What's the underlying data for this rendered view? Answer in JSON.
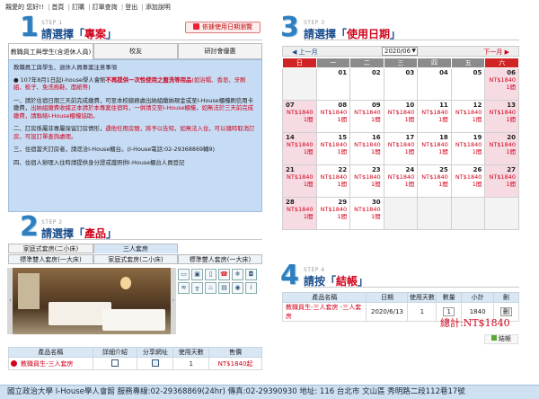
{
  "topnav": {
    "welcome": "親愛的 您好!!",
    "items": [
      "首頁",
      "訂購",
      "訂單查詢",
      "登出",
      "添加說明"
    ]
  },
  "step1": {
    "num": "1",
    "label": "STEP 1",
    "title_pre": "請選擇「",
    "title_key": "專案",
    "title_post": "」",
    "rule_button": "依據使用日期瀏覽",
    "tabs": [
      "教職員工與學生(含退休人員)",
      "校友",
      "研討會優惠"
    ],
    "heading": "教職員工與學生、退休人員專案注意事項",
    "notice_a": "107年8月1日起I-house學人會館",
    "notice_b": "不再提供一次性使用之盥洗等用品",
    "notice_c": "(如浴帽、香皂、牙刷組、梳子、免洗拖鞋、面紙等)",
    "p1": "一、請於住宿日期三天前完成繳費，可至本校總務處出納組繳納現金或至I-House櫃檯刷信用卡繳費，",
    "p1_red": "出納組繳費收據正本請於本專案住宿時，一併請交至I-House櫃檯，如無法於三天前完成繳費，請聯絡I-House櫃檯協助。",
    "p2": "二、訂房係屬非專屬保留訂房情形，",
    "p2_red": "遇他任用房間，將予以告知，如無法入住，可以隨時取消訂房，可設訂單查詢處理。",
    "p3": "三、住宿當天訂房者，請逕洽I-House櫃台。(I-House電話:02-29368869轉9)",
    "p4": "四、住宿人辦理入住時請提供身分證或護照供I-House櫃台人員登記"
  },
  "step2": {
    "num": "2",
    "label": "STEP 2",
    "title_pre": "請選擇「",
    "title_key": "產品",
    "title_post": "」",
    "tabs": [
      "家庭式套房(二小床)",
      "三人套房",
      ""
    ],
    "subtabs": [
      "標準雙人套房(一大床)",
      "家庭式套房(二小床)",
      "標準雙人套房(一大床)"
    ],
    "icons": [
      "bed-icon",
      "tv-icon",
      "fridge-icon",
      "phone-icon",
      "ac-icon",
      "safe-icon",
      "wifi-icon",
      "desk-icon",
      "lamp-icon",
      "towel-icon",
      "kettle-icon",
      "info-icon"
    ],
    "table_headers": [
      "產品名稱",
      "詳細介紹",
      "分享網址",
      "使用天數",
      "售價"
    ],
    "row": {
      "name": "教職員生-三人套房",
      "days": "1",
      "price": "NT$1840起"
    }
  },
  "step3": {
    "num": "3",
    "label": "STEP 3",
    "title_pre": "請選擇「",
    "title_key": "使用日期",
    "title_post": "」",
    "prev": "上一月",
    "next": "下一月",
    "month": "2020/06",
    "weekdays": [
      "日",
      "一",
      "二",
      "三",
      "四",
      "五",
      "六"
    ],
    "price": "NT$1840",
    "rooms": "1間",
    "weeks": [
      [
        {
          "d": "",
          "p": false
        },
        {
          "d": "01",
          "p": false
        },
        {
          "d": "02",
          "p": false
        },
        {
          "d": "03",
          "p": false
        },
        {
          "d": "04",
          "p": false
        },
        {
          "d": "05",
          "p": false
        },
        {
          "d": "06",
          "p": true
        }
      ],
      [
        {
          "d": "07",
          "p": true
        },
        {
          "d": "08",
          "p": true
        },
        {
          "d": "09",
          "p": true
        },
        {
          "d": "10",
          "p": true
        },
        {
          "d": "11",
          "p": true
        },
        {
          "d": "12",
          "p": true
        },
        {
          "d": "13",
          "p": true
        }
      ],
      [
        {
          "d": "14",
          "p": true
        },
        {
          "d": "15",
          "p": true
        },
        {
          "d": "16",
          "p": true
        },
        {
          "d": "17",
          "p": true
        },
        {
          "d": "18",
          "p": true
        },
        {
          "d": "19",
          "p": true
        },
        {
          "d": "20",
          "p": true
        }
      ],
      [
        {
          "d": "21",
          "p": true
        },
        {
          "d": "22",
          "p": true
        },
        {
          "d": "23",
          "p": true
        },
        {
          "d": "24",
          "p": true
        },
        {
          "d": "25",
          "p": true
        },
        {
          "d": "26",
          "p": true
        },
        {
          "d": "27",
          "p": true
        }
      ],
      [
        {
          "d": "28",
          "p": true
        },
        {
          "d": "29",
          "p": true
        },
        {
          "d": "30",
          "p": true
        },
        {
          "d": "",
          "p": false
        },
        {
          "d": "",
          "p": false
        },
        {
          "d": "",
          "p": false
        },
        {
          "d": "",
          "p": false
        }
      ]
    ]
  },
  "step4": {
    "num": "4",
    "label": "STEP 4",
    "title_pre": "請按「",
    "title_key": "結帳",
    "title_post": "」",
    "headers": [
      "產品名稱",
      "日期",
      "使用天數",
      "數量",
      "小計",
      "刪"
    ],
    "row": {
      "name_a": "教職員生-三人套房",
      "name_b": " -三人套房",
      "date": "2020/6/13",
      "days": "1",
      "qty": "1",
      "subtotal": "1840",
      "del": "刪"
    },
    "total": "總計:NT$1840",
    "checkout": "結帳"
  },
  "footer": {
    "text": "國立政治大學 I-House學人會館   服務專線:02-29368869(24hr)   傳真:02-29390930   地址: 116 台北市 文山區 秀明路二段112巷17號"
  }
}
